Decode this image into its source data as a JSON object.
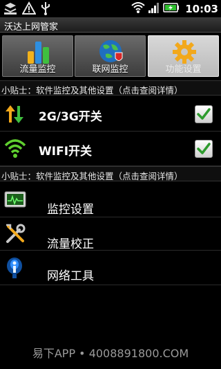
{
  "status_bar": {
    "time": "10:03",
    "left_icons": [
      "usb-debug-icon",
      "warning-icon",
      "usb-icon"
    ],
    "right_icons": [
      "wifi-icon",
      "signal-icon",
      "battery-charging-icon"
    ]
  },
  "app": {
    "title": "沃达上网管家"
  },
  "tabs": [
    {
      "label": "流量监控",
      "icon": "bar-chart-icon",
      "active": false
    },
    {
      "label": "联网监控",
      "icon": "globe-shield-icon",
      "active": false
    },
    {
      "label": "功能设置",
      "icon": "gear-icon",
      "active": true
    }
  ],
  "tips": [
    {
      "text": "小贴士：软件监控及其他设置（点击查阅详情）"
    },
    {
      "text": "小贴士：软件监控及其他设置（点击查阅详情）"
    }
  ],
  "toggles": [
    {
      "label": "2G/3G开关",
      "icon": "data-transfer-icon",
      "checked": true
    },
    {
      "label": "WIFI开关",
      "icon": "wifi-icon",
      "checked": true
    }
  ],
  "menu": [
    {
      "label": "监控设置",
      "icon": "monitor-icon"
    },
    {
      "label": "流量校正",
      "icon": "tools-icon"
    },
    {
      "label": "网络工具",
      "icon": "network-tool-icon"
    }
  ],
  "watermark": "易下APP • 4008891800.COM",
  "colors": {
    "check_green": "#2e9b2e",
    "tab_active_bg": "#c8c8c8",
    "tab_bg": "#505050"
  }
}
